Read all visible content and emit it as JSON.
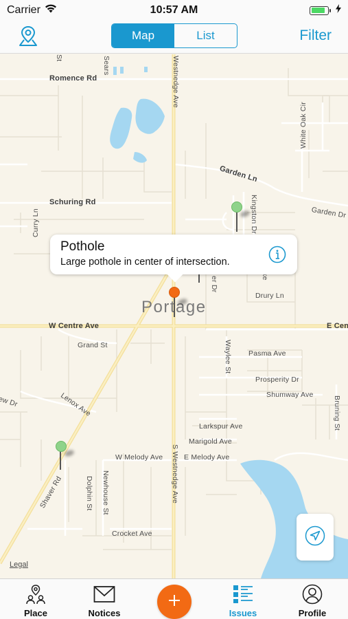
{
  "status_bar": {
    "carrier": "Carrier",
    "time": "10:57 AM",
    "battery_level": 0.85
  },
  "nav": {
    "place_icon": "map-pin-icon",
    "segments": [
      {
        "label": "Map",
        "active": true
      },
      {
        "label": "List",
        "active": false
      }
    ],
    "filter_label": "Filter"
  },
  "map": {
    "city": "Portage",
    "legal": "Legal",
    "streets": {
      "romence": "Romence Rd",
      "westnedge_n": "Westnedge Ave",
      "sears": "Sears",
      "st": "St",
      "white_oak": "White Oak Cir",
      "garden_ln": "Garden Ln",
      "garden_dr": "Garden Dr",
      "schuring": "Schuring Rd",
      "curry": "Curry Ln",
      "kingston": "Kingston Dr",
      "lake": "Lake",
      "er_dr": "er Dr",
      "drury": "Drury Ln",
      "w_centre": "W Centre Ave",
      "e_cent": "E Cent",
      "grand": "Grand St",
      "waylee": "Waylee St",
      "pasma": "Pasma Ave",
      "prosperity": "Prosperity Dr",
      "shumway": "Shumway Ave",
      "bruning": "Bruning St",
      "ew_dr": "ew Dr",
      "lenox": "Lenox Ave",
      "larkspur": "Larkspur Ave",
      "marigold": "Marigold Ave",
      "w_melody": "W Melody Ave",
      "e_melody": "E Melody Ave",
      "westnedge_s": "S Westnedge Ave",
      "shaver": "Shaver Rd",
      "dolphin": "Dolphin St",
      "newhouse": "Newhouse St",
      "crocket": "Crocket Ave"
    },
    "callout": {
      "title": "Pothole",
      "description": "Large pothole in center of intersection.",
      "info_icon": "info-icon"
    },
    "locate_icon": "location-arrow-icon"
  },
  "tabs": [
    {
      "label": "Place",
      "icon": "places-icon",
      "active": false
    },
    {
      "label": "Notices",
      "icon": "envelope-icon",
      "active": false
    },
    {
      "label": "Issues",
      "icon": "list-icon",
      "active": true
    },
    {
      "label": "Profile",
      "icon": "user-icon",
      "active": false
    }
  ],
  "add_icon": "plus-icon",
  "colors": {
    "accent": "#1a98cf",
    "add": "#f26a14",
    "water": "#a5d7f1",
    "road": "#f7e6a5",
    "map_bg": "#f8f4ea"
  }
}
